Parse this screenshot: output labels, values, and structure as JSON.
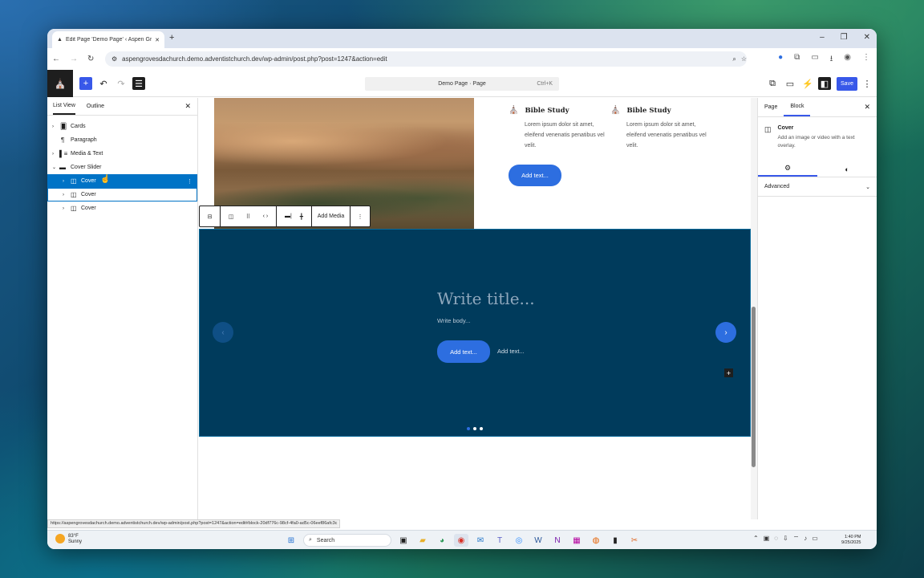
{
  "browser": {
    "tab_title": "Edit Page 'Demo Page' ‹ Aspen Gr",
    "new_tab": "+",
    "url": "aspengrovesdachurch.demo.adventistchurch.dev/wp-admin/post.php?post=1247&action=edit"
  },
  "editor_header": {
    "document_title": "Demo Page · Page",
    "shortcut": "Ctrl+K",
    "save_label": "Save"
  },
  "list_view": {
    "tabs": [
      "List View",
      "Outline"
    ],
    "items": [
      {
        "label": "Cards"
      },
      {
        "label": "Paragraph"
      },
      {
        "label": "Media & Text"
      },
      {
        "label": "Cover Slider"
      },
      {
        "label": "Cover"
      },
      {
        "label": "Cover"
      },
      {
        "label": "Cover"
      }
    ]
  },
  "content": {
    "cards": [
      {
        "title": "Bible Study",
        "body": "Lorem ipsum dolor sit amet, eleifend venenatis penatibus vel velit."
      },
      {
        "title": "Bible Study",
        "body": "Lorem ipsum dolor sit amet, eleifend venenatis penatibus vel velit."
      }
    ],
    "button_text": "Add text...",
    "block_toolbar": {
      "add_media": "Add Media"
    },
    "cover": {
      "title": "Write title...",
      "body": "Write body...",
      "button": "Add text...",
      "link": "Add text...",
      "dots_total": 3,
      "active_dot": 1,
      "background": "#003b5c"
    }
  },
  "inspector": {
    "tabs": [
      "Page",
      "Block"
    ],
    "block_name": "Cover",
    "block_desc": "Add an image or video with a text overlay.",
    "advanced_label": "Advanced"
  },
  "status_url": "https://aspengrovesdachurch.demo.adventistchurch.dev/wp-admin/post.php?post=1247&action=edit#block-20df776c-98cf-4fa0-ad5c-06eef86afc3c",
  "taskbar": {
    "weather_temp": "83°F",
    "weather_desc": "Sunny",
    "search_placeholder": "Search",
    "time": "1:40 PM",
    "date": "9/25/2025"
  },
  "colors": {
    "accent": "#3858e9",
    "selection": "#0073c6",
    "button_blue": "#2d6ee0"
  }
}
